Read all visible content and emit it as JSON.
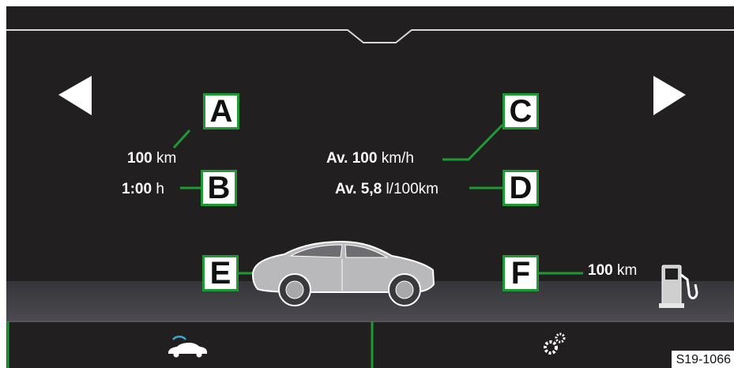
{
  "nav": {
    "prev_label": "previous",
    "next_label": "next"
  },
  "trip": {
    "distance": {
      "value": "100",
      "unit": "km"
    },
    "duration": {
      "value": "1:00",
      "unit": "h"
    },
    "avg_speed": {
      "prefix": "Av.",
      "value": "100",
      "unit": "km/h"
    },
    "avg_consumption": {
      "prefix": "Av.",
      "value": "5,8",
      "unit": "l/100km"
    },
    "range": {
      "value": "100",
      "unit": "km"
    }
  },
  "callouts": {
    "a": "A",
    "b": "B",
    "c": "C",
    "d": "D",
    "e": "E",
    "f": "F"
  },
  "bottom_bar": {
    "left_icon": "car-connection-icon",
    "right_icon": "settings-gears-icon"
  },
  "figure_code": "S19-1066",
  "colors": {
    "background": "#221f20",
    "accent": "#1e9a34",
    "text": "#ffffff",
    "connect_icon": "#3aa6d6"
  }
}
